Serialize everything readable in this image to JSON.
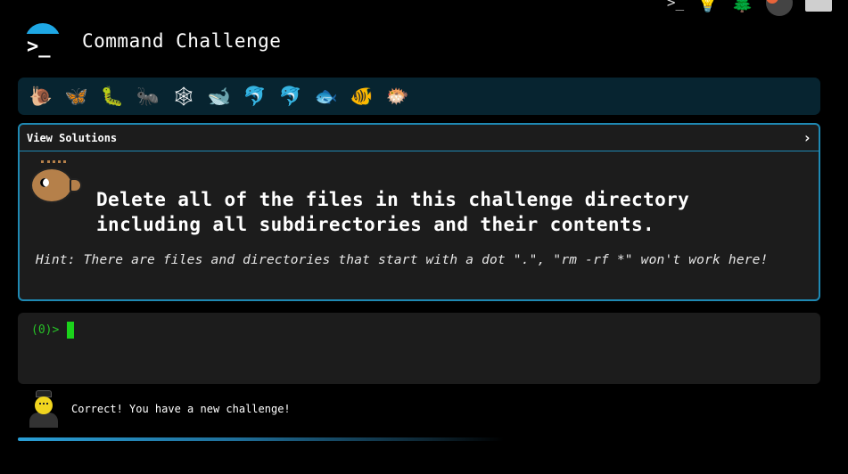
{
  "app": {
    "title": "Command Challenge"
  },
  "top_icons": [
    {
      "name": "terminal-icon",
      "glyph": ">_"
    },
    {
      "name": "lightbulb-icon",
      "glyph": "💡"
    },
    {
      "name": "tree-icon",
      "glyph": "🌲"
    },
    {
      "name": "shield-badge-icon",
      "glyph": ""
    },
    {
      "name": "mail-icon",
      "glyph": ""
    }
  ],
  "emoji_bar": [
    {
      "name": "snail-icon",
      "glyph": "🐌"
    },
    {
      "name": "butterfly-icon",
      "glyph": "🦋"
    },
    {
      "name": "caterpillar-icon",
      "glyph": "🐛"
    },
    {
      "name": "ant-icon",
      "glyph": "🐜"
    },
    {
      "name": "spider-web-icon",
      "glyph": "🕸"
    },
    {
      "name": "whale-icon",
      "glyph": "🐋"
    },
    {
      "name": "dolphin-icon",
      "glyph": "🐬"
    },
    {
      "name": "dolphin-gray-icon",
      "glyph": "🐬"
    },
    {
      "name": "fish-icon",
      "glyph": "🐟"
    },
    {
      "name": "tropical-fish-icon",
      "glyph": "🐠"
    },
    {
      "name": "blowfish-icon",
      "glyph": "🐡"
    }
  ],
  "card": {
    "solutions_label": "View Solutions",
    "chevron": "›",
    "description": "Delete all of the files in this challenge directory including all subdirectories and their contents.",
    "hint": "Hint: There are files and directories that start with a dot \".\", \"rm -rf *\" won't work here!"
  },
  "terminal": {
    "prompt": "(0)>"
  },
  "status": {
    "message": "Correct! You have a new challenge!"
  },
  "colors": {
    "accent": "#1f89b3",
    "cursor": "#1bd21b",
    "prompt": "#27c227",
    "panel": "#1c1c1c",
    "emoji_bar_bg": "#072430"
  }
}
